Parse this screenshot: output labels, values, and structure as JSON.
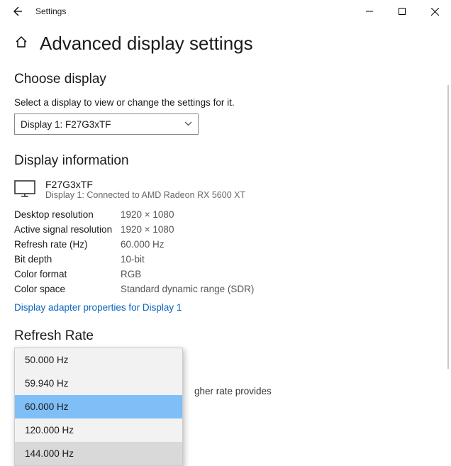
{
  "window": {
    "title": "Settings"
  },
  "page": {
    "title": "Advanced display settings"
  },
  "choose": {
    "heading": "Choose display",
    "desc": "Select a display to view or change the settings for it.",
    "selected": "Display 1: F27G3xTF"
  },
  "info": {
    "heading": "Display information",
    "monitor_name": "F27G3xTF",
    "monitor_sub": "Display 1: Connected to AMD Radeon RX 5600 XT",
    "rows": [
      {
        "label": "Desktop resolution",
        "value": "1920 × 1080"
      },
      {
        "label": "Active signal resolution",
        "value": "1920 × 1080"
      },
      {
        "label": "Refresh rate (Hz)",
        "value": "60.000 Hz"
      },
      {
        "label": "Bit depth",
        "value": "10-bit"
      },
      {
        "label": "Color format",
        "value": "RGB"
      },
      {
        "label": "Color space",
        "value": "Standard dynamic range (SDR)"
      }
    ],
    "link": "Display adapter properties for Display 1"
  },
  "refresh": {
    "heading": "Refresh Rate",
    "partial_text": "gher rate provides",
    "options": [
      {
        "label": "50.000 Hz",
        "state": ""
      },
      {
        "label": "59.940 Hz",
        "state": ""
      },
      {
        "label": "60.000 Hz",
        "state": "selected"
      },
      {
        "label": "120.000 Hz",
        "state": ""
      },
      {
        "label": "144.000 Hz",
        "state": "hover"
      }
    ]
  }
}
